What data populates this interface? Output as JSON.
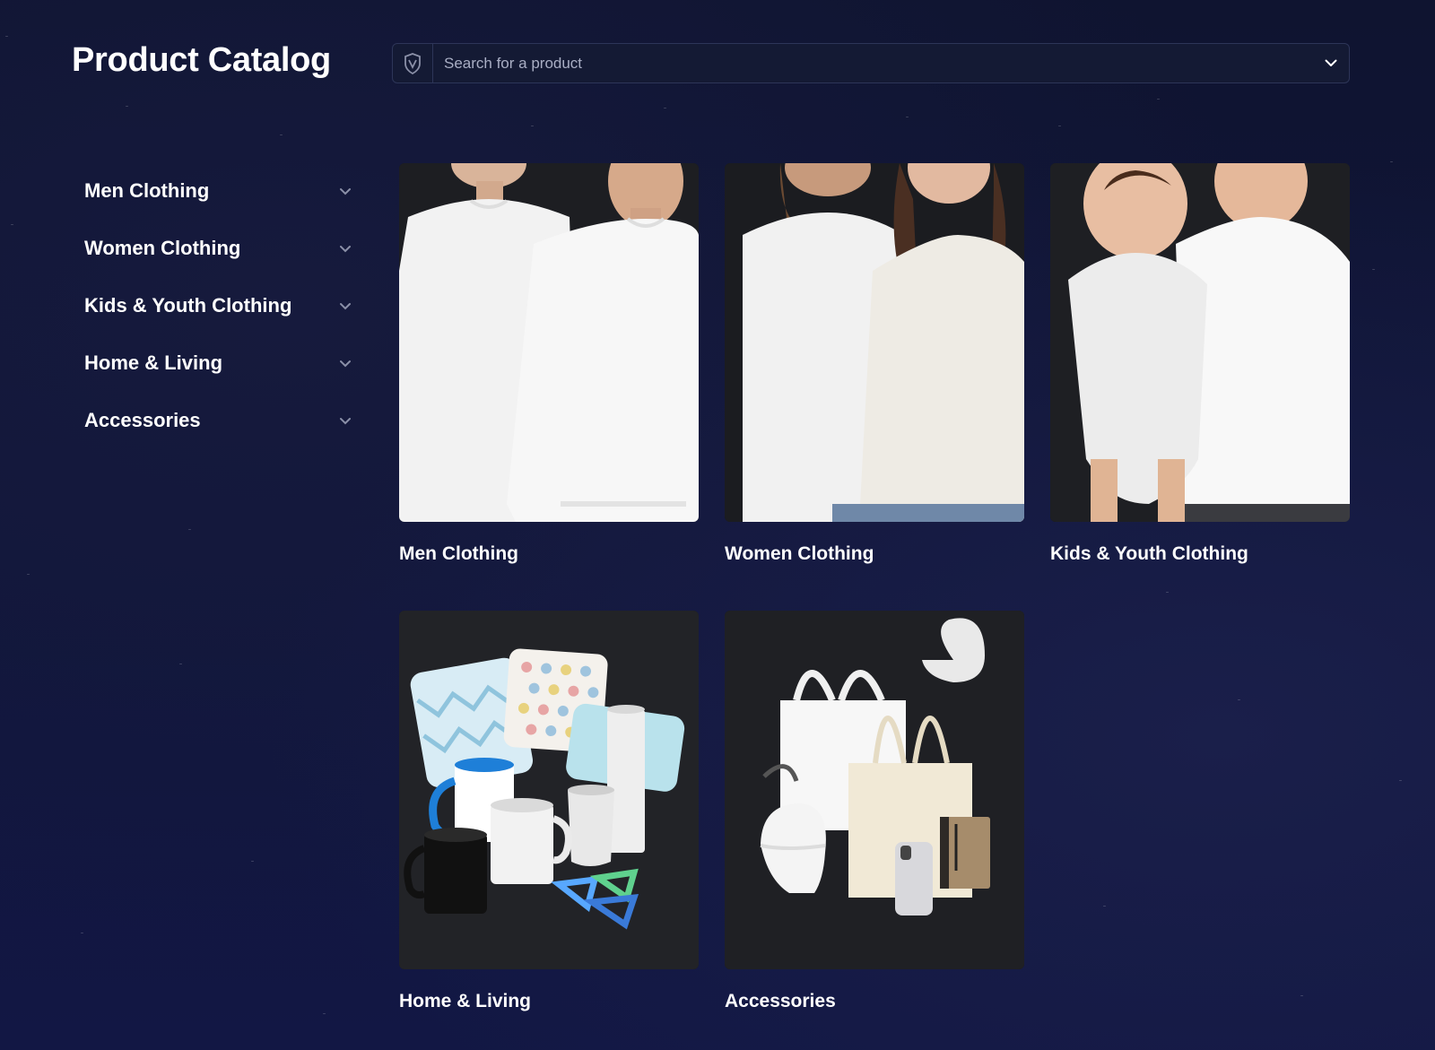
{
  "header": {
    "title": "Product Catalog",
    "search": {
      "placeholder": "Search for a product",
      "value": ""
    }
  },
  "sidebar": {
    "items": [
      {
        "label": "Men Clothing"
      },
      {
        "label": "Women Clothing"
      },
      {
        "label": "Kids & Youth Clothing"
      },
      {
        "label": "Home & Living"
      },
      {
        "label": "Accessories"
      }
    ]
  },
  "catalog": {
    "cards": [
      {
        "label": "Men Clothing",
        "image": "men-clothing-image"
      },
      {
        "label": "Women Clothing",
        "image": "women-clothing-image"
      },
      {
        "label": "Kids & Youth Clothing",
        "image": "kids-youth-clothing-image"
      },
      {
        "label": "Home & Living",
        "image": "home-living-image"
      },
      {
        "label": "Accessories",
        "image": "accessories-image"
      }
    ]
  },
  "colors": {
    "background": "#10153a",
    "search_background": "#141a34",
    "search_border": "#2d3558",
    "text": "#ffffff",
    "chevron": "#8b90a8"
  },
  "icons": {
    "search_logo": "shield-logo-icon",
    "dropdown": "chevron-down-icon"
  }
}
